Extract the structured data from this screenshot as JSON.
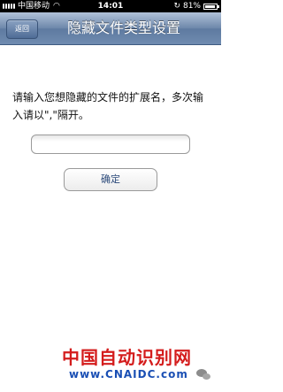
{
  "status_bar": {
    "carrier": "中国移动",
    "time": "14:01",
    "battery": "81%",
    "battery_level": 0.81
  },
  "nav": {
    "back_label": "返回",
    "title": "隐藏文件类型设置"
  },
  "form": {
    "instruction": "请输入您想隐藏的文件的扩展名，多次输入请以\",\"隔开。",
    "input_value": "",
    "confirm_label": "确定"
  },
  "watermark": {
    "name": "中国自动识别网",
    "url": "www.CNAIDC.com"
  }
}
